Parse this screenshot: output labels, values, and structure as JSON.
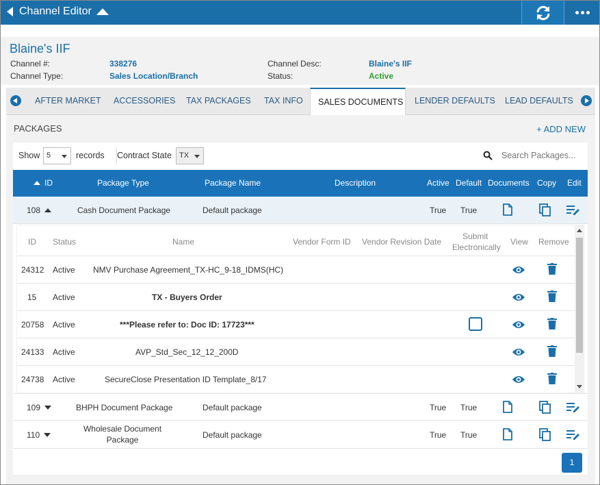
{
  "app": {
    "title": "Channel Editor"
  },
  "header": {
    "name": "Blaine's IIF",
    "channel_num_label": "Channel #:",
    "channel_num": "338276",
    "channel_type_label": "Channel Type:",
    "channel_type": "Sales Location/Branch",
    "channel_desc_label": "Channel Desc:",
    "channel_desc": "Blaine's IIF",
    "status_label": "Status:",
    "status": "Active"
  },
  "tabs": [
    {
      "label": "AFTER MARKET"
    },
    {
      "label": "ACCESSORIES"
    },
    {
      "label": "TAX PACKAGES"
    },
    {
      "label": "TAX INFO"
    },
    {
      "label": "SALES DOCUMENTS",
      "active": true
    },
    {
      "label": "LENDER DEFAULTS"
    },
    {
      "label": "LEAD DEFAULTS"
    }
  ],
  "packages": {
    "title": "PACKAGES",
    "add_new": "+ ADD NEW",
    "show_label": "Show",
    "show_value": "5",
    "records_label": "records",
    "contract_state_label": "Contract State",
    "contract_state_value": "TX",
    "search_placeholder": "Search Packages...",
    "columns": {
      "id": "ID",
      "package_type": "Package Type",
      "package_name": "Package Name",
      "description": "Description",
      "active": "Active",
      "default": "Default",
      "documents": "Documents",
      "copy": "Copy",
      "edit": "Edit"
    },
    "rows": [
      {
        "id": "108",
        "type": "Cash Document Package",
        "name": "Default package",
        "description": "",
        "active": "True",
        "default": "True",
        "expanded": true
      },
      {
        "id": "109",
        "type": "BHPH Document Package",
        "name": "Default package",
        "description": "",
        "active": "True",
        "default": "True",
        "expanded": false
      },
      {
        "id": "110",
        "type_line1": "Wholesale Document",
        "type_line2": "Package",
        "name": "Default package",
        "description": "",
        "active": "True",
        "default": "True",
        "expanded": false
      }
    ],
    "page": "1"
  },
  "documents": {
    "columns": {
      "id": "ID",
      "status": "Status",
      "name": "Name",
      "vendor_form_id": "Vendor Form ID",
      "vendor_revision_date": "Vendor Revision Date",
      "submit_line1": "Submit",
      "submit_line2": "Electronically",
      "view": "View",
      "remove": "Remove"
    },
    "rows": [
      {
        "id": "24312",
        "status": "Active",
        "name": "NMV Purchase Agreement_TX-HC_9-18_IDMS(HC)",
        "bold": false,
        "checkbox": false
      },
      {
        "id": "15",
        "status": "Active",
        "name": "TX - Buyers Order",
        "bold": true,
        "checkbox": false
      },
      {
        "id": "20758",
        "status": "Active",
        "name": "***Please refer to: Doc ID: 17723***",
        "bold": true,
        "checkbox": true
      },
      {
        "id": "24133",
        "status": "Active",
        "name": "AVP_Std_Sec_12_12_200D",
        "bold": false,
        "checkbox": false
      },
      {
        "id": "24738",
        "status": "Active",
        "name": "SecureClose Presentation ID Template_8/17",
        "bold": false,
        "checkbox": false
      }
    ]
  },
  "colors": {
    "primary": "#1a6fa8",
    "header_blue": "#1a73b8",
    "active_green": "#2ea02e"
  }
}
